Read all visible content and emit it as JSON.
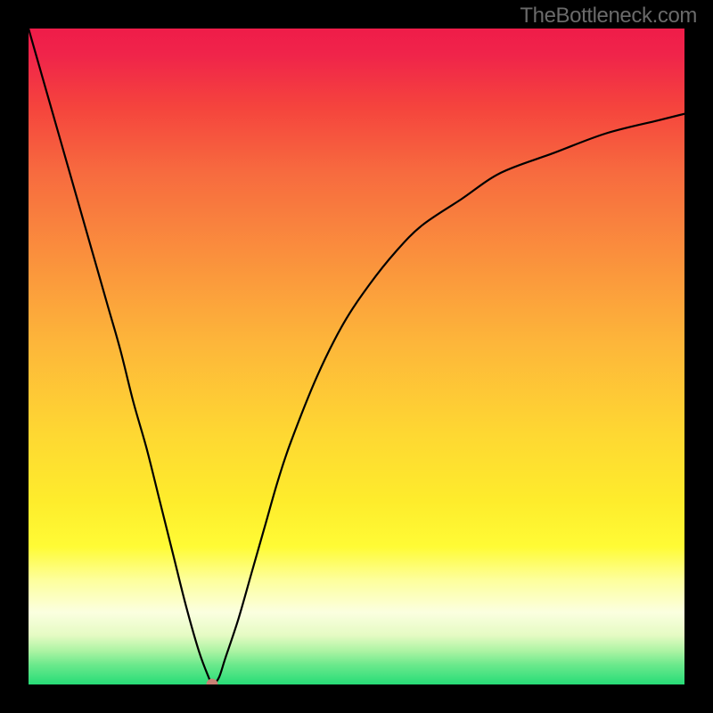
{
  "watermark": "TheBottleneck.com",
  "chart_data": {
    "type": "line",
    "title": "",
    "xlabel": "",
    "ylabel": "",
    "xlim": [
      0,
      100
    ],
    "ylim": [
      0,
      100
    ],
    "series": [
      {
        "name": "bottleneck-curve",
        "x": [
          0,
          2,
          4,
          6,
          8,
          10,
          12,
          14,
          16,
          18,
          20,
          22,
          24,
          26,
          27.5,
          28,
          29,
          30,
          32,
          34,
          36,
          38,
          40,
          44,
          48,
          52,
          56,
          60,
          66,
          72,
          80,
          88,
          96,
          100
        ],
        "values": [
          100,
          93,
          86,
          79,
          72,
          65,
          58,
          51,
          43,
          36,
          28,
          20,
          12,
          5,
          1,
          0,
          1,
          4,
          10,
          17,
          24,
          31,
          37,
          47,
          55,
          61,
          66,
          70,
          74,
          78,
          81,
          84,
          86,
          87
        ]
      }
    ],
    "marker": {
      "x": 28,
      "y": 0,
      "name": "optimal-point"
    },
    "annotations": [],
    "legend": false,
    "grid": false
  },
  "colors": {
    "curve": "#000000",
    "marker": "#c98175",
    "frame": "#000000"
  }
}
